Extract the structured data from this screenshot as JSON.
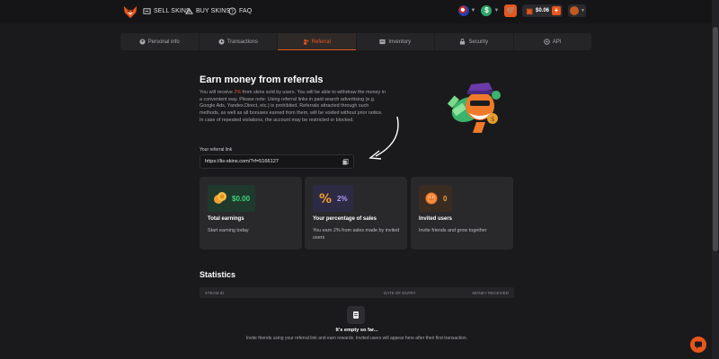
{
  "header": {
    "sell_skins": "SELL SKINS",
    "buy_skins": "BUY SKINS",
    "faq": "FAQ",
    "balance": "$0.06"
  },
  "tabs": [
    {
      "label": "Personal info",
      "icon": "user-icon"
    },
    {
      "label": "Transactions",
      "icon": "history-icon"
    },
    {
      "label": "Referral",
      "icon": "users-icon",
      "active": true
    },
    {
      "label": "Inventory",
      "icon": "inventory-icon"
    },
    {
      "label": "Security",
      "icon": "lock-icon"
    },
    {
      "label": "API",
      "icon": "api-icon"
    }
  ],
  "referral": {
    "title": "Earn money from referrals",
    "desc_before": "You will receive ",
    "desc_highlight": "2%",
    "desc_after": " from skins sold by users. You will be able to withdraw the money in a convenient way. Please note: Using referral links in paid search advertising (e.g. Google Ads, Yandex.Direct, etc.) is prohibited. Referrals attracted through such methods, as well as all bonuses earned from them, will be voided without prior notice. In case of repeated violations, the account may be restricted or blocked.",
    "link_label": "Your referral link",
    "link": "https://lis-skins.com/?rf=5166127"
  },
  "cards": [
    {
      "value": "$0.00",
      "title": "Total earnings",
      "sub": "Start earning today"
    },
    {
      "value": "2%",
      "title": "Your percentage of sales",
      "sub": "You earn 2% from sales made by invited users"
    },
    {
      "value": "0",
      "title": "Invited users",
      "sub": "Invite friends and grow together"
    }
  ],
  "stats": {
    "title": "Statistics",
    "col_steam_id": "STEAM ID",
    "col_date": "DATE OF ENTRY",
    "col_money": "MONEY RECEIVED",
    "empty_title": "It's empty so far...",
    "empty_sub": "Invite friends using your referral link and earn rewards. Invited users will appear here after their first transaction."
  },
  "colors": {
    "accent": "#e8561b",
    "background": "#1a1a1d",
    "card": "#29292c",
    "green": "#3bd57e",
    "purple": "#b39df5"
  }
}
